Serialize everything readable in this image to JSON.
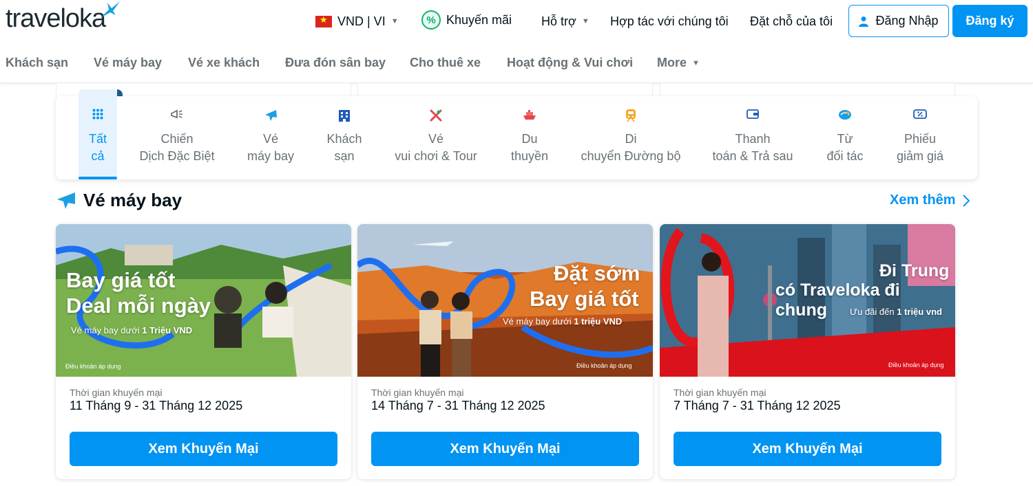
{
  "brand": {
    "logo_text": "traveloka",
    "colors": {
      "primary": "#0194f3",
      "text": "#03121a",
      "muted": "#687176"
    }
  },
  "header": {
    "currency_lang": "VND | VI",
    "promo": "Khuyến mãi",
    "support": "Hỗ trợ",
    "partner": "Hợp tác với chúng tôi",
    "bookings": "Đặt chỗ của tôi",
    "login": "Đăng Nhập",
    "register": "Đăng ký"
  },
  "nav": {
    "items": [
      "Khách sạn",
      "Vé máy bay",
      "Vé xe khách",
      "Đưa đón sân bay",
      "Cho thuê xe",
      "Hoạt động & Vui chơi"
    ],
    "more": "More"
  },
  "categories": [
    {
      "line1": "Tất",
      "line2": "cả",
      "icon": "grid-icon",
      "active": true
    },
    {
      "line1": "Chiến",
      "line2": "Dịch Đặc Biệt",
      "icon": "megaphone-icon",
      "active": false
    },
    {
      "line1": "Vé",
      "line2": "máy bay",
      "icon": "plane-icon",
      "active": false
    },
    {
      "line1": "Khách",
      "line2": "sạn",
      "icon": "hotel-icon",
      "active": false
    },
    {
      "line1": "Vé",
      "line2": "vui chơi & Tour",
      "icon": "attraction-icon",
      "active": false
    },
    {
      "line1": "Du",
      "line2": "thuyền",
      "icon": "cruise-icon",
      "active": false
    },
    {
      "line1": "Di",
      "line2": "chuyển Đường bộ",
      "icon": "train-icon",
      "active": false
    },
    {
      "line1": "Thanh",
      "line2": "toán & Trả sau",
      "icon": "wallet-icon",
      "active": false
    },
    {
      "line1": "Từ",
      "line2": "đối tác",
      "icon": "partner-icon",
      "active": false
    },
    {
      "line1": "Phiếu",
      "line2": "giảm giá",
      "icon": "coupon-icon",
      "active": false
    }
  ],
  "section": {
    "title": "Vé máy bay",
    "see_more": "Xem thêm"
  },
  "cards": [
    {
      "img_line1": "Bay giá tốt",
      "img_line2": "Deal mỗi ngày",
      "img_sub_prefix": "Vé máy bay dưới ",
      "img_sub_bold": "1 Triệu VND",
      "img_terms": "Điều khoản áp dụng",
      "label": "Thời gian khuyến mại",
      "date": "11 Tháng 9 - 31 Tháng 12 2025",
      "button": "Xem Khuyến Mại"
    },
    {
      "img_line1": "Đặt sớm",
      "img_line2": "Bay giá tốt",
      "img_sub_prefix": "Vé máy bay dưới ",
      "img_sub_bold": "1 triệu VND",
      "img_terms": "Điều khoản áp dụng",
      "label": "Thời gian khuyến mại",
      "date": "14 Tháng 7 - 31 Tháng 12 2025",
      "button": "Xem Khuyến Mại"
    },
    {
      "img_line1": "Đi Trung",
      "img_line2": "có Traveloka đi chung",
      "img_sub_prefix": "Ưu đãi đến ",
      "img_sub_bold": "1 triệu vnd",
      "img_terms": "Điều khoản áp dụng",
      "label": "Thời gian khuyến mại",
      "date": "7 Tháng 7 - 31 Tháng 12 2025",
      "button": "Xem Khuyến Mại"
    }
  ]
}
